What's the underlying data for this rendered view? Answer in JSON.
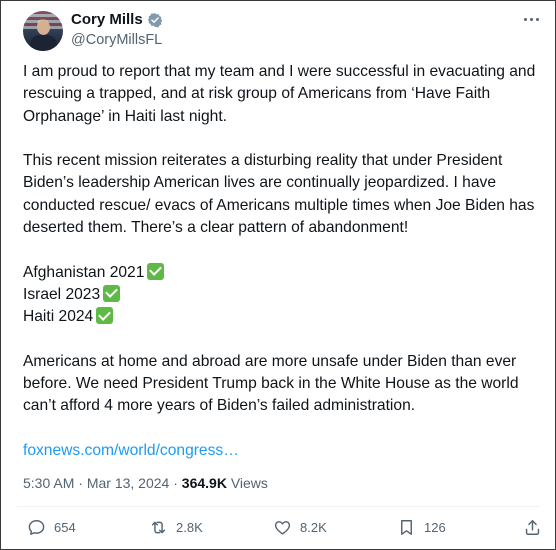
{
  "author": {
    "name": "Cory Mills",
    "handle": "@CoryMillsFL",
    "verified_color": "#829aab"
  },
  "tweet": {
    "p1": "I am proud to report that my team and I were successful in evacuating and rescuing a trapped, and at risk group of Americans from ‘Have Faith Orphanage’ in Haiti last night.",
    "p2": "This recent mission reiterates a disturbing reality that under President Biden’s leadership American lives are continually jeopardized. I have conducted rescue/ evacs of Americans multiple times when Joe Biden has deserted them. There’s a clear pattern of abandonment!",
    "list": [
      "Afghanistan 2021",
      "Israel 2023",
      "Haiti 2024"
    ],
    "p3": "Americans at home and abroad are more unsafe under Biden than ever before. We need President Trump back in the White House as the world can’t afford 4 more years of Biden’s failed administration.",
    "link": "foxnews.com/world/congress…"
  },
  "meta": {
    "time": "5:30 AM",
    "date": "Mar 13, 2024",
    "views_count": "364.9K",
    "views_label": "Views",
    "separator": " · "
  },
  "actions": {
    "replies": "654",
    "reposts": "2.8K",
    "likes": "8.2K",
    "bookmarks": "126"
  },
  "icons": [
    "check-icon",
    "more-icon",
    "reply-icon",
    "repost-icon",
    "like-icon",
    "bookmark-icon",
    "share-icon"
  ],
  "colors": {
    "link": "#1d9bf0",
    "check": "#5fb947",
    "muted": "#536471"
  }
}
